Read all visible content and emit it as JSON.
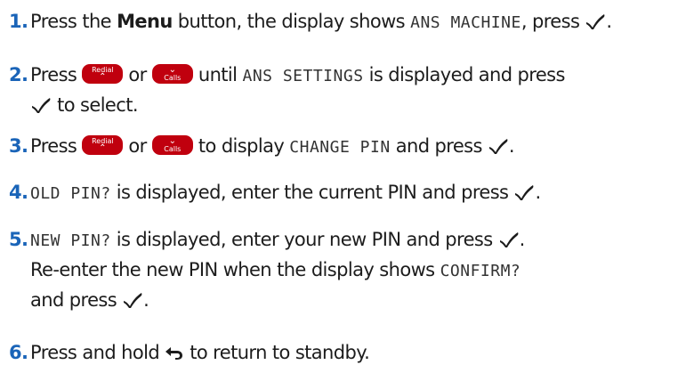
{
  "steps": [
    {
      "num": "1.",
      "t1": "Press the ",
      "t2": "Menu",
      "t3": " button, the display shows ",
      "lcd1": "ANS MACHINE",
      "t4": ", press "
    },
    {
      "num": "2.",
      "t1": "Press ",
      "t2": " or ",
      "t3": " until ",
      "lcd1": "ANS SETTINGS",
      "t4": " is displayed and press",
      "t5": " to select."
    },
    {
      "num": "3.",
      "t1": "Press ",
      "t2": " or ",
      "t3": " to display ",
      "lcd1": "CHANGE PIN",
      "t4": " and press ",
      "t5": "."
    },
    {
      "num": "4.",
      "lcd1": "OLD PIN?",
      "t1": " is displayed, enter the current PIN and press ",
      "t2": "."
    },
    {
      "num": "5.",
      "lcd1": "NEW PIN?",
      "t1": " is displayed, enter your new PIN and press ",
      "t2": ".",
      "t3": "Re-enter the new PIN when the display shows ",
      "lcd2": "CONFIRM?",
      "t4": "and press ",
      "t5": "."
    },
    {
      "num": "6.",
      "t1": "Press and hold ",
      "t2": " to return to standby."
    }
  ],
  "keys": {
    "redial_label": "Redial",
    "calls_label": "Calls",
    "up_glyph": "⌃",
    "down_glyph": "⌄"
  },
  "icons": {
    "ok": "checkmark-icon",
    "back": "back-arrow-icon",
    "key_color": "#c0000e",
    "number_color": "#1a64b8"
  }
}
